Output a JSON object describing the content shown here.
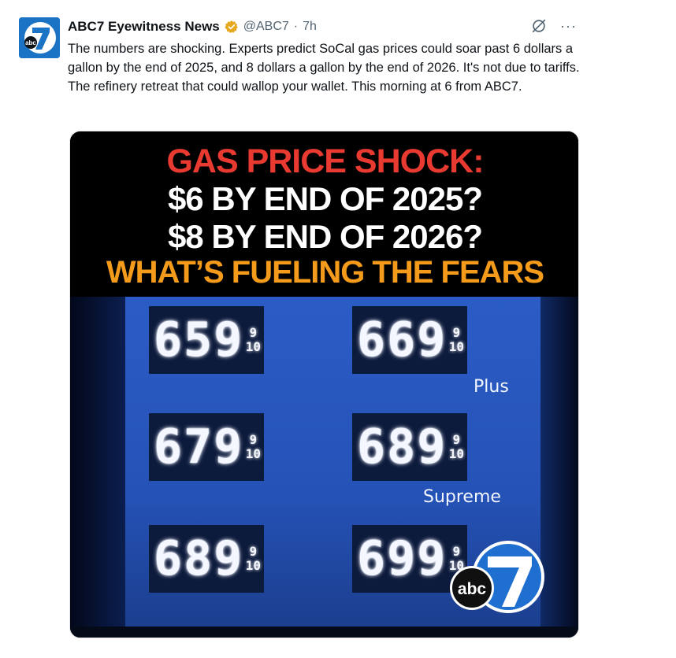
{
  "tweet": {
    "display_name": "ABC7 Eyewitness News",
    "handle": "@ABC7",
    "separator": "·",
    "time": "7h",
    "more_label": "···",
    "text": "The numbers are shocking. Experts predict SoCal gas prices could soar past 6 dollars a gallon by the end of 2025, and 8 dollars a gallon by the end of 2026. It's not due to tariffs. The refinery retreat that could wallop your wallet. This morning at 6 from ABC7.",
    "icons": {
      "avatar": "abc7-logo-icon",
      "verified": "verified-badge-icon",
      "grok": "grok-icon",
      "more": "more-icon"
    },
    "colors": {
      "verified": "#e5a81e",
      "avatar_bg": "#1a73c5"
    }
  },
  "media": {
    "headline": {
      "line1": "GAS PRICE SHOCK:",
      "line2": "$6 BY END OF 2025?",
      "line3": "$8 BY END OF 2026?",
      "line4": "WHAT’S FUELING THE FEARS",
      "colors": {
        "line1": "#e83a30",
        "line2": "#ffffff",
        "line4": "#f59b1b"
      }
    },
    "prices": [
      {
        "digits": "659",
        "tenth_top": "9",
        "tenth_bottom": "10"
      },
      {
        "digits": "669",
        "tenth_top": "9",
        "tenth_bottom": "10"
      },
      {
        "digits": "679",
        "tenth_top": "9",
        "tenth_bottom": "10"
      },
      {
        "digits": "689",
        "tenth_top": "9",
        "tenth_bottom": "10"
      },
      {
        "digits": "689",
        "tenth_top": "9",
        "tenth_bottom": "10"
      },
      {
        "digits": "699",
        "tenth_top": "9",
        "tenth_bottom": "10"
      }
    ],
    "grades": {
      "plus": "Plus",
      "supreme": "Supreme"
    },
    "logo_text": "abc"
  }
}
